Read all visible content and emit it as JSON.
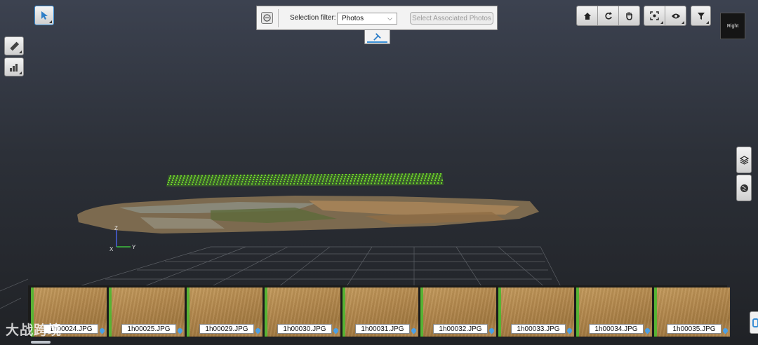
{
  "selection_filter": {
    "label": "Selection filter:",
    "value": "Photos",
    "options_visible": [
      "Photos"
    ],
    "associated_button": "Select Associated Photos"
  },
  "viewcube": {
    "face_label": "Right"
  },
  "axis_labels": {
    "z": "Z",
    "x": "X",
    "y": "Y"
  },
  "toolbar": {
    "left": [
      "selection-cursor-icon",
      "measure-ruler-icon",
      "chart-icon"
    ],
    "right": [
      "home-icon",
      "rotate-icon",
      "hand-pan-icon",
      "zoom-extent-icon",
      "eye-icon",
      "filter-icon"
    ],
    "side": [
      "layers-icon",
      "globe-icon"
    ]
  },
  "photos": [
    {
      "name": "1h00024.JPG"
    },
    {
      "name": "1h00025.JPG"
    },
    {
      "name": "1h00029.JPG"
    },
    {
      "name": "1h00030.JPG"
    },
    {
      "name": "1h00031.JPG"
    },
    {
      "name": "1h00032.JPG"
    },
    {
      "name": "1h00033.JPG"
    },
    {
      "name": "1h00034.JPG"
    },
    {
      "name": "1h00035.JPG"
    }
  ],
  "watermark": "大战跨境",
  "colors": {
    "camera_markers": "#6fd62a",
    "accent": "#3a8fd6",
    "thumb_border": "#58b334"
  }
}
